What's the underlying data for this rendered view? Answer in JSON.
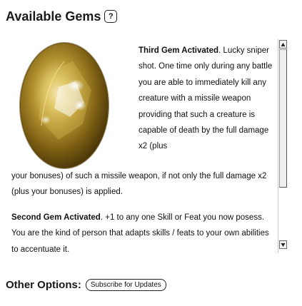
{
  "header": {
    "title": "Available Gems",
    "help_icon": "?"
  },
  "gem_image": {
    "icon": "gem-icon",
    "color": "#c8a33a"
  },
  "content": {
    "p1_title": "Third Gem Activated",
    "p1_top": ". Lucky sniper shot. One time only during any battle you are able to immediately kill any creature with a missile weapon providing that such a creature is capable of death by the full damage x2 (plus",
    "p1_rest": "your bonuses) of such a missile weapon, if not only the full damage x2 (plus your bonuses) is applied.",
    "p2_title": "Second Gem Activated",
    "p2_text": ". +1 to any one Skill or Feat you now posess. You are the kind of person that adapts skills / feats to your own abilities to accentuate it."
  },
  "footer": {
    "label": "Other Options:",
    "subscribe_button": "Subscribe for Updates"
  }
}
